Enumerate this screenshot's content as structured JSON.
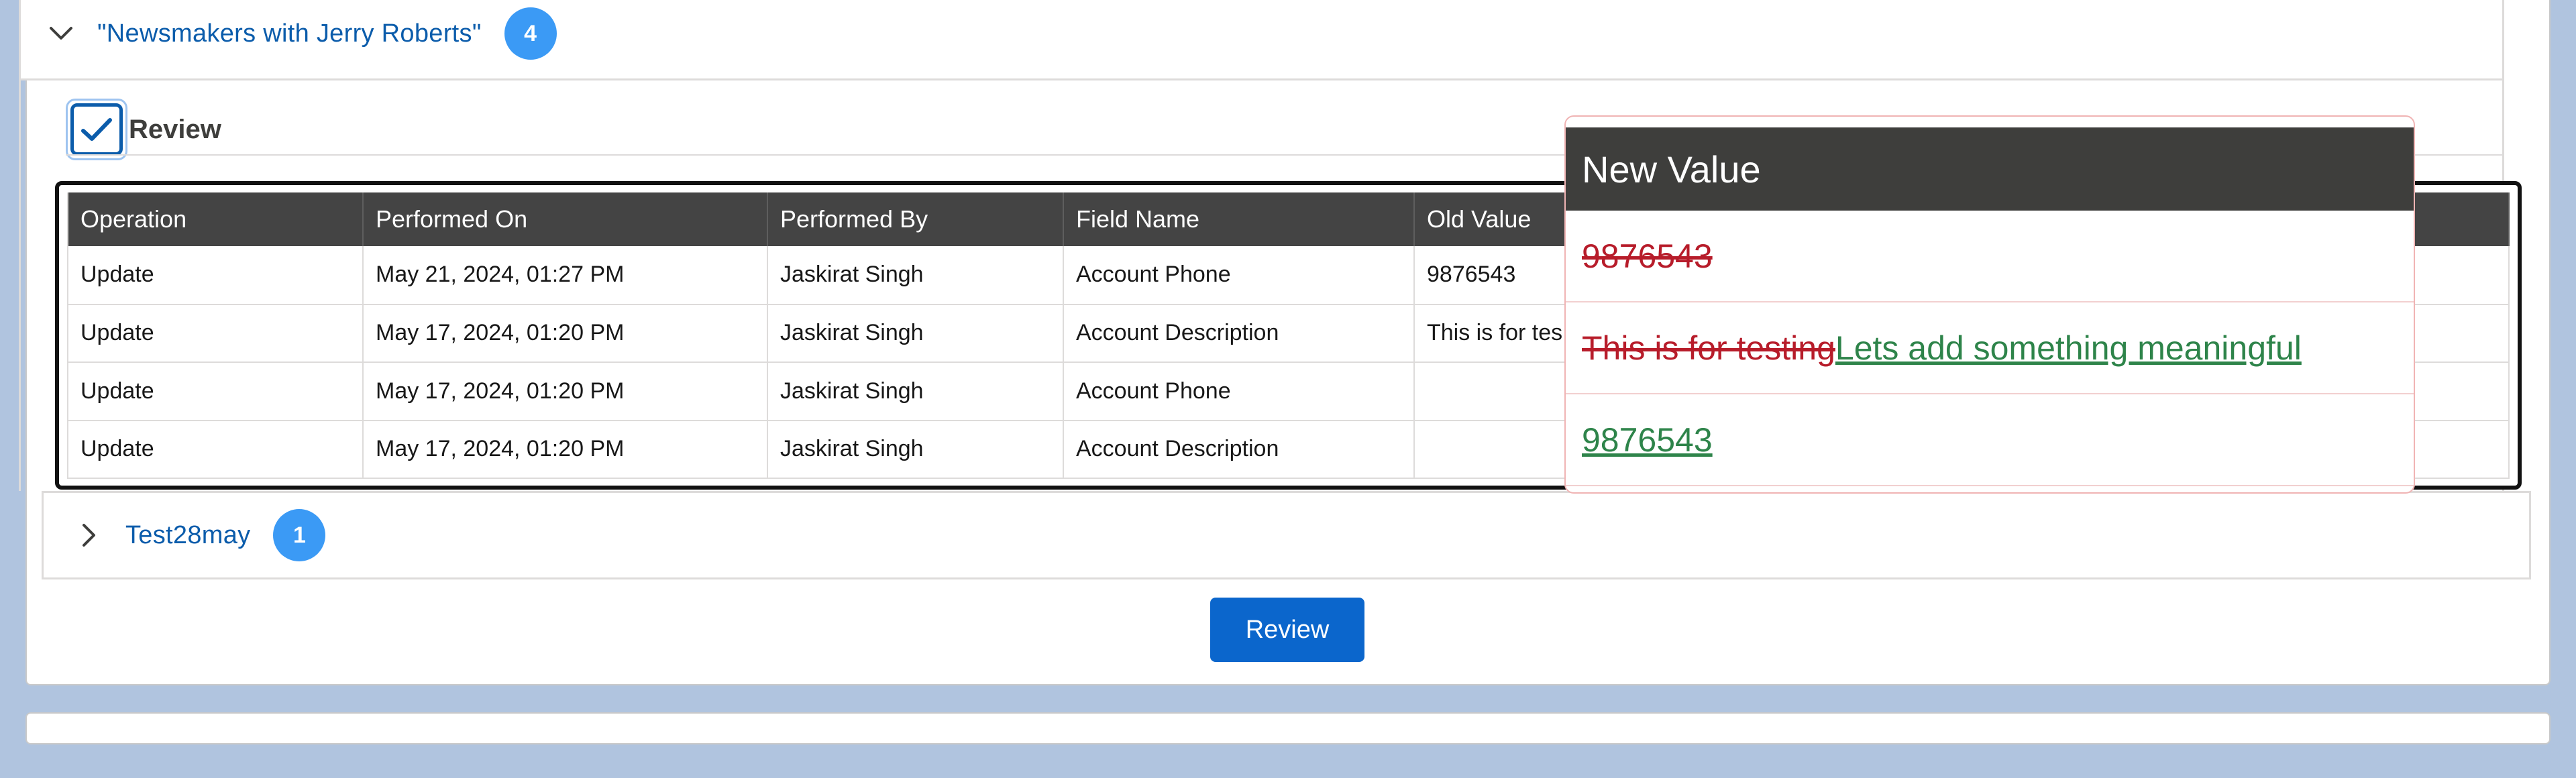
{
  "sections": [
    {
      "title": "\"Newsmakers with Jerry Roberts\"",
      "count": "4",
      "expanded": true
    },
    {
      "title": "Test28may",
      "count": "1",
      "expanded": false
    }
  ],
  "review_checkbox": {
    "label": "Review",
    "checked": true
  },
  "table": {
    "columns": [
      "Operation",
      "Performed On",
      "Performed By",
      "Field Name",
      "Old Value",
      ""
    ],
    "rows": [
      [
        "Update",
        "May 21, 2024, 01:27 PM",
        "Jaskirat Singh",
        "Account Phone",
        "9876543",
        ""
      ],
      [
        "Update",
        "May 17, 2024, 01:20 PM",
        "Jaskirat Singh",
        "Account Description",
        "This is for tes",
        ""
      ],
      [
        "Update",
        "May 17, 2024, 01:20 PM",
        "Jaskirat Singh",
        "Account Phone",
        "",
        ""
      ],
      [
        "Update",
        "May 17, 2024, 01:20 PM",
        "Jaskirat Singh",
        "Account Description",
        "",
        ""
      ]
    ]
  },
  "popover": {
    "title": "New Value",
    "rows": [
      {
        "removed": "9876543",
        "added": ""
      },
      {
        "removed": "This is for testing",
        "added": "Lets add something meaningful"
      },
      {
        "removed": "",
        "added": "9876543"
      }
    ]
  },
  "review_button": {
    "label": "Review"
  },
  "colors": {
    "accent": "#0b5cab",
    "badge": "#3b9af5",
    "button": "#0b66cc",
    "table_header": "#444444",
    "removed_text": "#b71c2a",
    "added_text": "#2e844a",
    "page_background": "#b0c4df"
  }
}
